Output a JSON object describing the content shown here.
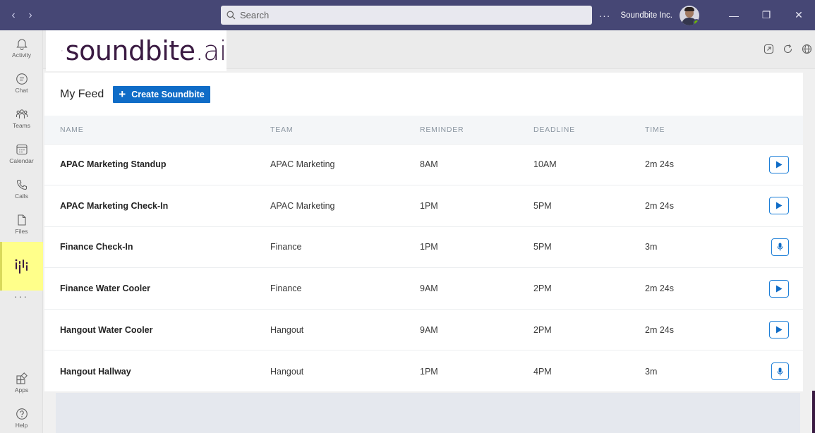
{
  "titlebar": {
    "back": "‹",
    "forward": "›",
    "search_placeholder": "Search",
    "more": "···",
    "org_name": "Soundbite Inc.",
    "minimize": "—",
    "maximize": "❐",
    "close": "✕"
  },
  "rail": {
    "items": [
      {
        "label": "Activity",
        "icon": "bell-icon"
      },
      {
        "label": "Chat",
        "icon": "chat-icon"
      },
      {
        "label": "Teams",
        "icon": "teams-icon"
      },
      {
        "label": "Calendar",
        "icon": "calendar-icon"
      },
      {
        "label": "Calls",
        "icon": "phone-icon"
      },
      {
        "label": "Files",
        "icon": "file-icon"
      }
    ],
    "active_app_icon": "soundbite-icon",
    "more": "···",
    "bottom": [
      {
        "label": "Apps",
        "icon": "apps-icon"
      },
      {
        "label": "Help",
        "icon": "help-icon"
      }
    ]
  },
  "app": {
    "logo_text_main": "soundbite",
    "logo_text_ai": ".ai"
  },
  "feed": {
    "title": "My Feed",
    "create_label": "Create Soundbite",
    "columns": [
      "NAME",
      "TEAM",
      "REMINDER",
      "DEADLINE",
      "TIME"
    ],
    "rows": [
      {
        "name": "APAC Marketing Standup",
        "team": "APAC Marketing",
        "reminder": "8AM",
        "deadline": "10AM",
        "time": "2m 24s",
        "action": "play"
      },
      {
        "name": "APAC Marketing Check-In",
        "team": "APAC Marketing",
        "reminder": "1PM",
        "deadline": "5PM",
        "time": "2m 24s",
        "action": "play"
      },
      {
        "name": "Finance Check-In",
        "team": "Finance",
        "reminder": "1PM",
        "deadline": "5PM",
        "time": "3m",
        "action": "record"
      },
      {
        "name": "Finance Water Cooler",
        "team": "Finance",
        "reminder": "9AM",
        "deadline": "2PM",
        "time": "2m 24s",
        "action": "play"
      },
      {
        "name": "Hangout Water Cooler",
        "team": "Hangout",
        "reminder": "9AM",
        "deadline": "2PM",
        "time": "2m 24s",
        "action": "play"
      },
      {
        "name": "Hangout Hallway",
        "team": "Hangout",
        "reminder": "1PM",
        "deadline": "4PM",
        "time": "3m",
        "action": "record"
      }
    ]
  },
  "colors": {
    "titlebar": "#464775",
    "accent_blue": "#0f6cc7",
    "brand_purple": "#3a1a42",
    "active_highlight": "#ffff8a"
  }
}
